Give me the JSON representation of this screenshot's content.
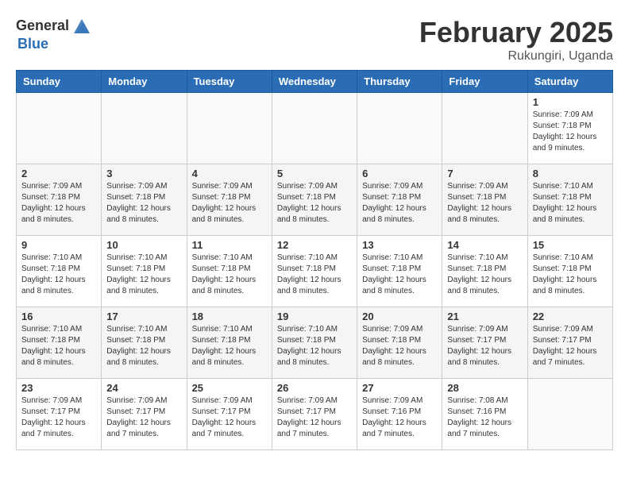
{
  "header": {
    "logo_general": "General",
    "logo_blue": "Blue",
    "month_title": "February 2025",
    "location": "Rukungiri, Uganda"
  },
  "days_of_week": [
    "Sunday",
    "Monday",
    "Tuesday",
    "Wednesday",
    "Thursday",
    "Friday",
    "Saturday"
  ],
  "weeks": [
    [
      {
        "day": "",
        "info": ""
      },
      {
        "day": "",
        "info": ""
      },
      {
        "day": "",
        "info": ""
      },
      {
        "day": "",
        "info": ""
      },
      {
        "day": "",
        "info": ""
      },
      {
        "day": "",
        "info": ""
      },
      {
        "day": "1",
        "info": "Sunrise: 7:09 AM\nSunset: 7:18 PM\nDaylight: 12 hours and 9 minutes."
      }
    ],
    [
      {
        "day": "2",
        "info": "Sunrise: 7:09 AM\nSunset: 7:18 PM\nDaylight: 12 hours and 8 minutes."
      },
      {
        "day": "3",
        "info": "Sunrise: 7:09 AM\nSunset: 7:18 PM\nDaylight: 12 hours and 8 minutes."
      },
      {
        "day": "4",
        "info": "Sunrise: 7:09 AM\nSunset: 7:18 PM\nDaylight: 12 hours and 8 minutes."
      },
      {
        "day": "5",
        "info": "Sunrise: 7:09 AM\nSunset: 7:18 PM\nDaylight: 12 hours and 8 minutes."
      },
      {
        "day": "6",
        "info": "Sunrise: 7:09 AM\nSunset: 7:18 PM\nDaylight: 12 hours and 8 minutes."
      },
      {
        "day": "7",
        "info": "Sunrise: 7:09 AM\nSunset: 7:18 PM\nDaylight: 12 hours and 8 minutes."
      },
      {
        "day": "8",
        "info": "Sunrise: 7:10 AM\nSunset: 7:18 PM\nDaylight: 12 hours and 8 minutes."
      }
    ],
    [
      {
        "day": "9",
        "info": "Sunrise: 7:10 AM\nSunset: 7:18 PM\nDaylight: 12 hours and 8 minutes."
      },
      {
        "day": "10",
        "info": "Sunrise: 7:10 AM\nSunset: 7:18 PM\nDaylight: 12 hours and 8 minutes."
      },
      {
        "day": "11",
        "info": "Sunrise: 7:10 AM\nSunset: 7:18 PM\nDaylight: 12 hours and 8 minutes."
      },
      {
        "day": "12",
        "info": "Sunrise: 7:10 AM\nSunset: 7:18 PM\nDaylight: 12 hours and 8 minutes."
      },
      {
        "day": "13",
        "info": "Sunrise: 7:10 AM\nSunset: 7:18 PM\nDaylight: 12 hours and 8 minutes."
      },
      {
        "day": "14",
        "info": "Sunrise: 7:10 AM\nSunset: 7:18 PM\nDaylight: 12 hours and 8 minutes."
      },
      {
        "day": "15",
        "info": "Sunrise: 7:10 AM\nSunset: 7:18 PM\nDaylight: 12 hours and 8 minutes."
      }
    ],
    [
      {
        "day": "16",
        "info": "Sunrise: 7:10 AM\nSunset: 7:18 PM\nDaylight: 12 hours and 8 minutes."
      },
      {
        "day": "17",
        "info": "Sunrise: 7:10 AM\nSunset: 7:18 PM\nDaylight: 12 hours and 8 minutes."
      },
      {
        "day": "18",
        "info": "Sunrise: 7:10 AM\nSunset: 7:18 PM\nDaylight: 12 hours and 8 minutes."
      },
      {
        "day": "19",
        "info": "Sunrise: 7:10 AM\nSunset: 7:18 PM\nDaylight: 12 hours and 8 minutes."
      },
      {
        "day": "20",
        "info": "Sunrise: 7:09 AM\nSunset: 7:18 PM\nDaylight: 12 hours and 8 minutes."
      },
      {
        "day": "21",
        "info": "Sunrise: 7:09 AM\nSunset: 7:17 PM\nDaylight: 12 hours and 8 minutes."
      },
      {
        "day": "22",
        "info": "Sunrise: 7:09 AM\nSunset: 7:17 PM\nDaylight: 12 hours and 7 minutes."
      }
    ],
    [
      {
        "day": "23",
        "info": "Sunrise: 7:09 AM\nSunset: 7:17 PM\nDaylight: 12 hours and 7 minutes."
      },
      {
        "day": "24",
        "info": "Sunrise: 7:09 AM\nSunset: 7:17 PM\nDaylight: 12 hours and 7 minutes."
      },
      {
        "day": "25",
        "info": "Sunrise: 7:09 AM\nSunset: 7:17 PM\nDaylight: 12 hours and 7 minutes."
      },
      {
        "day": "26",
        "info": "Sunrise: 7:09 AM\nSunset: 7:17 PM\nDaylight: 12 hours and 7 minutes."
      },
      {
        "day": "27",
        "info": "Sunrise: 7:09 AM\nSunset: 7:16 PM\nDaylight: 12 hours and 7 minutes."
      },
      {
        "day": "28",
        "info": "Sunrise: 7:08 AM\nSunset: 7:16 PM\nDaylight: 12 hours and 7 minutes."
      },
      {
        "day": "",
        "info": ""
      }
    ]
  ]
}
